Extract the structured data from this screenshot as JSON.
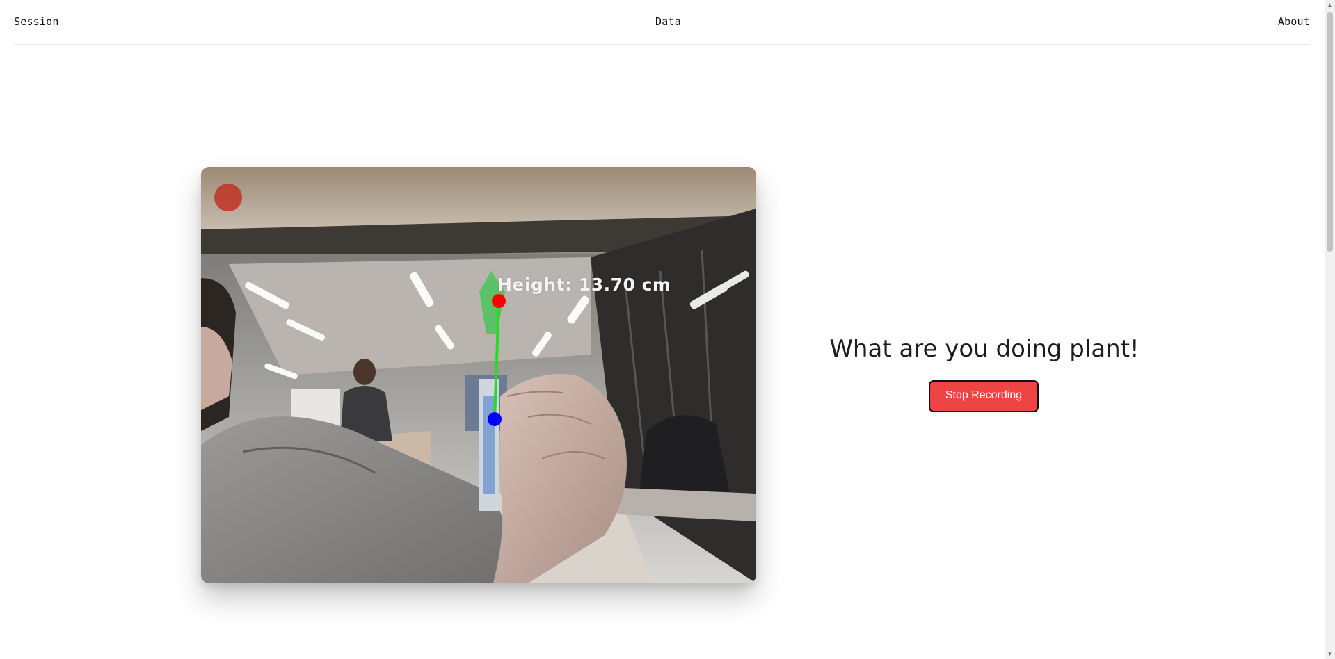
{
  "nav": {
    "session": "Session",
    "data": "Data",
    "about": "About"
  },
  "camera": {
    "overlay_text": "Height: 13.70 cm",
    "recording_indicator_color": "#c0392b",
    "top_marker_color": "#ff0000",
    "bottom_marker_color": "#0000ff",
    "measure_line_color": "#22dd22"
  },
  "main": {
    "title": "What are you doing plant!",
    "stop_button_label": "Stop Recording",
    "stop_button_color": "#ef4444"
  }
}
